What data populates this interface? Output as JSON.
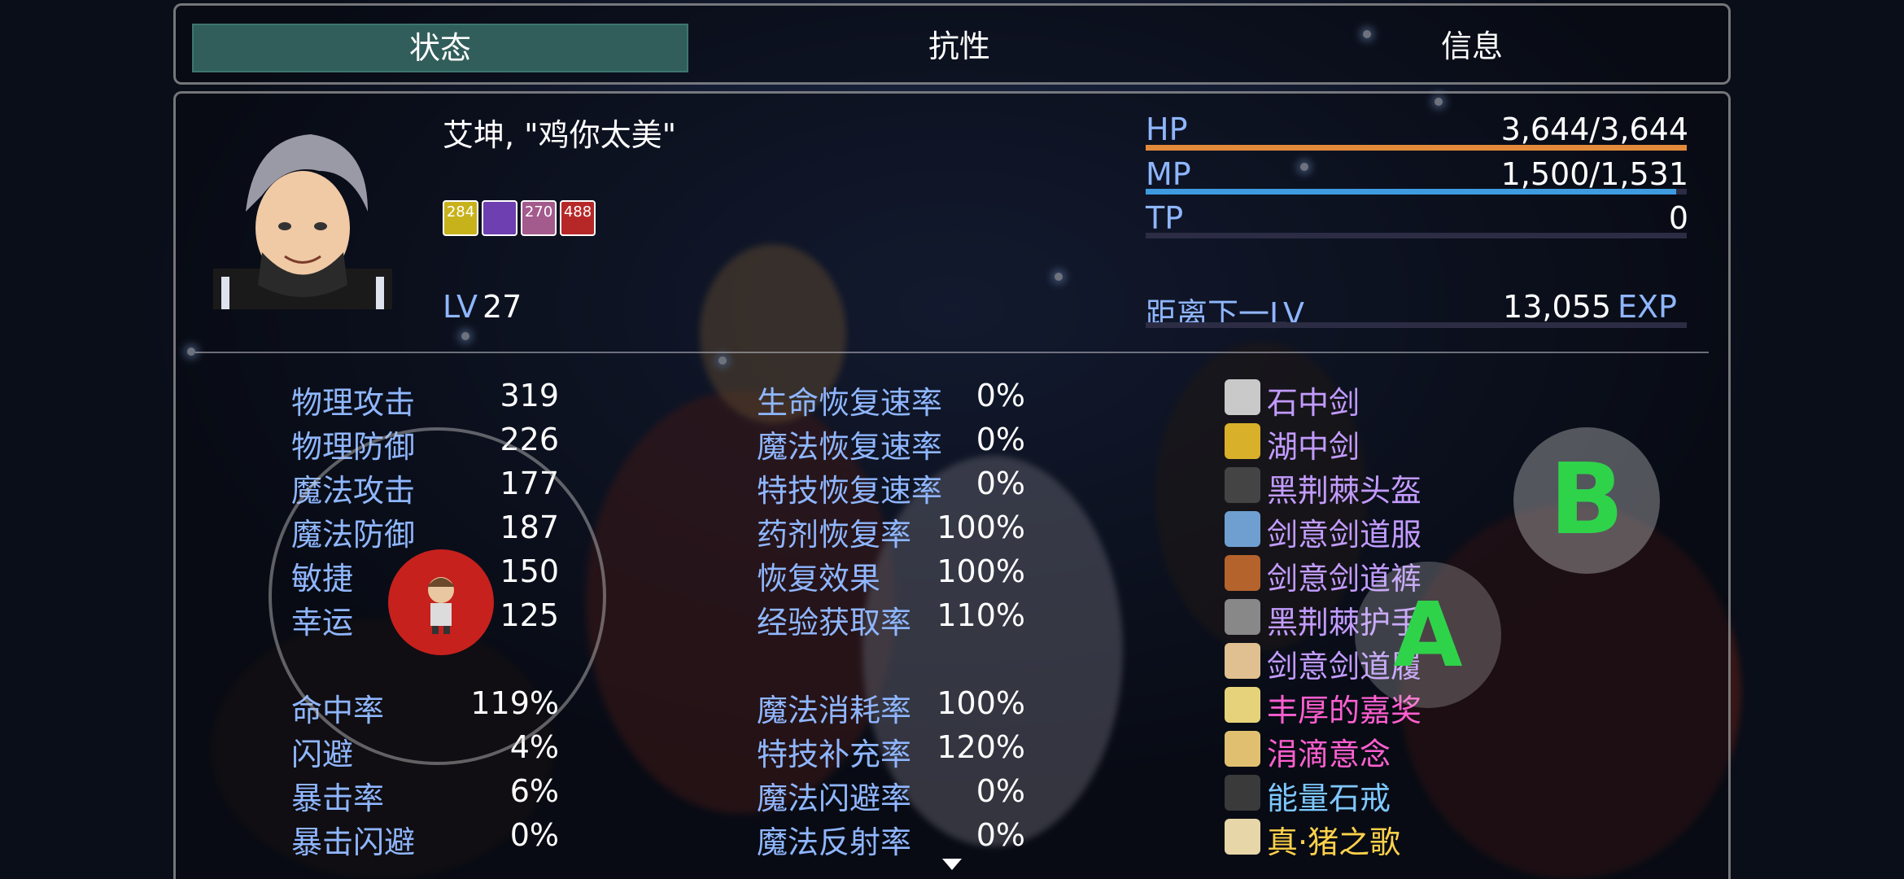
{
  "tabs": {
    "status": "状态",
    "resist": "抗性",
    "info": "信息"
  },
  "actor": {
    "name": "艾坤, \"鸡你太美\"",
    "level_label": "LV",
    "level": "27"
  },
  "states": [
    {
      "value": "284",
      "color": "#c8b21c"
    },
    {
      "value": "",
      "color": "#6d3fb0"
    },
    {
      "value": "270",
      "color": "#a35a8c"
    },
    {
      "value": "488",
      "color": "#b62828"
    }
  ],
  "gauges": {
    "hp": {
      "label": "HP",
      "value": "3,644/3,644",
      "ratio": 1.0,
      "color": "#e38a3a"
    },
    "mp": {
      "label": "MP",
      "value": "1,500/1,531",
      "ratio": 0.98,
      "color": "#3e9be0"
    },
    "tp": {
      "label": "TP",
      "value": "0",
      "ratio": 0.0,
      "color": "#4a8f3a"
    }
  },
  "exp": {
    "label": "距离下一LV",
    "value": "13,055",
    "unit": "EXP"
  },
  "params": [
    {
      "label": "物理攻击",
      "value": "319"
    },
    {
      "label": "物理防御",
      "value": "226"
    },
    {
      "label": "魔法攻击",
      "value": "177"
    },
    {
      "label": "魔法防御",
      "value": "187"
    },
    {
      "label": "敏捷",
      "value": "150"
    },
    {
      "label": "幸运",
      "value": "125"
    }
  ],
  "xparams": [
    {
      "label": "命中率",
      "value": "119%"
    },
    {
      "label": "闪避",
      "value": "4%"
    },
    {
      "label": "暴击率",
      "value": "6%"
    },
    {
      "label": "暴击闪避",
      "value": "0%"
    }
  ],
  "sparams1": [
    {
      "label": "生命恢复速率",
      "value": "0%"
    },
    {
      "label": "魔法恢复速率",
      "value": "0%"
    },
    {
      "label": "特技恢复速率",
      "value": "0%"
    },
    {
      "label": "药剂恢复率",
      "value": "100%"
    },
    {
      "label": "恢复效果",
      "value": "100%"
    },
    {
      "label": "经验获取率",
      "value": "110%"
    }
  ],
  "sparams2": [
    {
      "label": "魔法消耗率",
      "value": "100%"
    },
    {
      "label": "特技补充率",
      "value": "120%"
    },
    {
      "label": "魔法闪避率",
      "value": "0%"
    },
    {
      "label": "魔法反射率",
      "value": "0%"
    }
  ],
  "equipment": [
    {
      "name": "石中剑",
      "icon": "sword-icon",
      "color": "#c29bff"
    },
    {
      "name": "湖中剑",
      "icon": "golden-sword-icon",
      "color": "#c29bff"
    },
    {
      "name": "黑荆棘头盔",
      "icon": "helmet-icon",
      "color": "#c29bff"
    },
    {
      "name": "剑意剑道服",
      "icon": "robe-icon",
      "color": "#c29bff"
    },
    {
      "name": "剑意剑道裤",
      "icon": "boots-icon",
      "color": "#c29bff"
    },
    {
      "name": "黑荆棘护手",
      "icon": "gauntlet-icon",
      "color": "#c29bff"
    },
    {
      "name": "剑意剑道履",
      "icon": "shoes-icon",
      "color": "#c29bff"
    },
    {
      "name": "丰厚的嘉奖",
      "icon": "ring-icon",
      "color": "#ff5fd0"
    },
    {
      "name": "涓滴意念",
      "icon": "necklace-icon",
      "color": "#ff5fd0"
    },
    {
      "name": "能量石戒",
      "icon": "stone-ring-icon",
      "color": "#7ec8ff"
    },
    {
      "name": "真·猪之歌",
      "icon": "scroll-icon",
      "color": "#ffd24a"
    }
  ],
  "controls": {
    "a_label": "A",
    "b_label": "B"
  }
}
